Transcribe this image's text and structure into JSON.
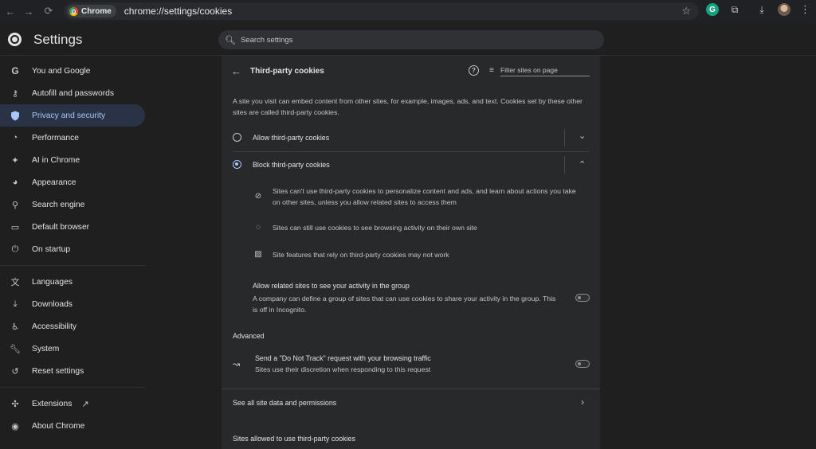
{
  "browser": {
    "chip_label": "Chrome",
    "url": "chrome://settings/cookies"
  },
  "header": {
    "title": "Settings",
    "search_placeholder": "Search settings"
  },
  "sidebar": {
    "items": [
      {
        "label": "You and Google",
        "icon": "google-icon"
      },
      {
        "label": "Autofill and passwords",
        "icon": "key-icon"
      },
      {
        "label": "Privacy and security",
        "icon": "shield-icon"
      },
      {
        "label": "Performance",
        "icon": "speedometer-icon"
      },
      {
        "label": "AI in Chrome",
        "icon": "sparkle-icon"
      },
      {
        "label": "Appearance",
        "icon": "palette-icon"
      },
      {
        "label": "Search engine",
        "icon": "search-icon"
      },
      {
        "label": "Default browser",
        "icon": "browser-icon"
      },
      {
        "label": "On startup",
        "icon": "power-icon"
      },
      {
        "label": "Languages",
        "icon": "translate-icon"
      },
      {
        "label": "Downloads",
        "icon": "download-icon"
      },
      {
        "label": "Accessibility",
        "icon": "accessibility-icon"
      },
      {
        "label": "System",
        "icon": "wrench-icon"
      },
      {
        "label": "Reset settings",
        "icon": "reset-icon"
      },
      {
        "label": "Extensions",
        "icon": "puzzle-icon"
      },
      {
        "label": "About Chrome",
        "icon": "chrome-icon"
      }
    ]
  },
  "page": {
    "title": "Third-party cookies",
    "filter_placeholder": "Filter sites on page",
    "description": "A site you visit can embed content from other sites, for example, images, ads, and text. Cookies set by these other sites are called third-party cookies.",
    "options": {
      "allow_label": "Allow third-party cookies",
      "block_label": "Block third-party cookies"
    },
    "block_details": [
      "Sites can't use third-party cookies to personalize content and ads, and learn about actions you take on other sites, unless you allow related sites to access them",
      "Sites can still use cookies to see browsing activity on their own site",
      "Site features that rely on third-party cookies may not work"
    ],
    "related_sites": {
      "title": "Allow related sites to see your activity in the group",
      "description": "A company can define a group of sites that can use cookies to share your activity in the group. This is off in Incognito."
    },
    "advanced": {
      "heading": "Advanced",
      "dnt_title": "Send a \"Do Not Track\" request with your browsing traffic",
      "dnt_description": "Sites use their discretion when responding to this request"
    },
    "see_all_label": "See all site data and permissions",
    "allowed_heading": "Sites allowed to use third-party cookies"
  },
  "colors": {
    "accent": "#a8c7fa",
    "active_bg": "#2a3346",
    "card_bg": "#28292a",
    "page_bg": "#1f1f1f"
  }
}
